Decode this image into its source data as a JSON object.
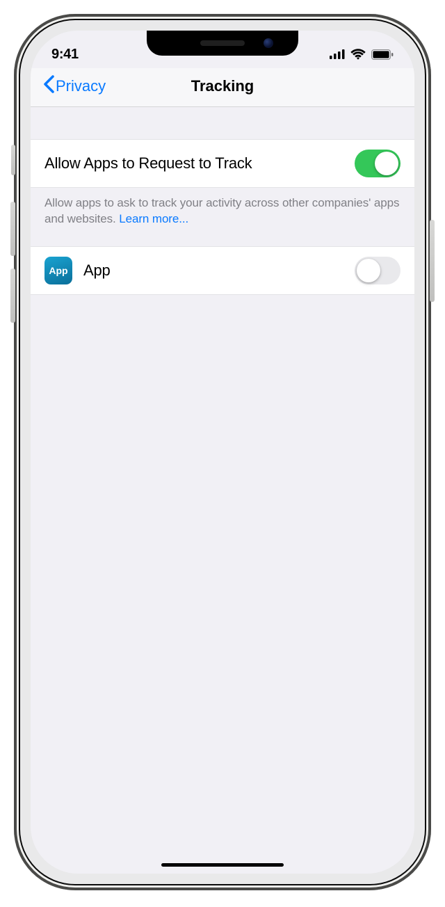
{
  "status_bar": {
    "time": "9:41"
  },
  "nav": {
    "back_label": "Privacy",
    "title": "Tracking"
  },
  "settings": {
    "allow_label": "Allow Apps to Request to Track",
    "allow_value": true,
    "footer_text": "Allow apps to ask to track your activity across other companies' apps and websites. ",
    "footer_link": "Learn more..."
  },
  "apps": [
    {
      "icon_label": "App",
      "name": "App",
      "tracking_enabled": false
    }
  ]
}
